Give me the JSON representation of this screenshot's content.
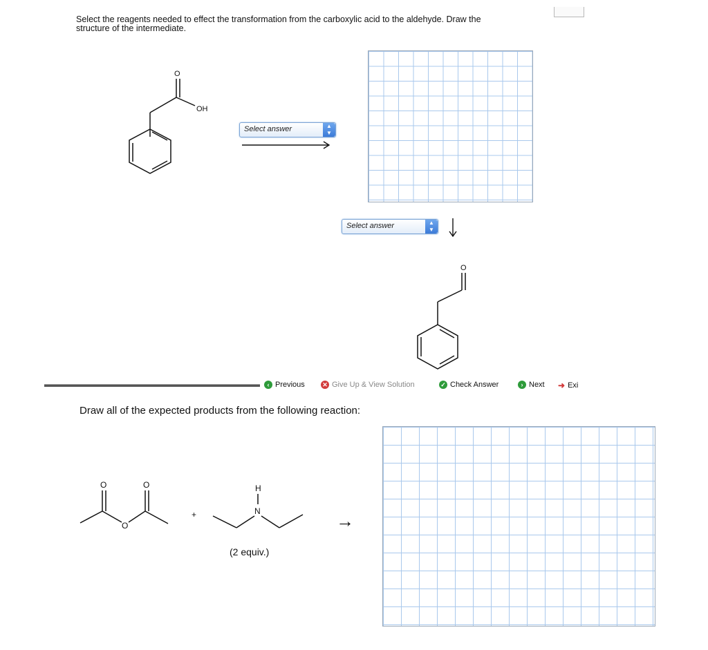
{
  "question1": {
    "prompt_line1": "Select the reagents needed to effect the transformation from the carboxylic acid to the aldehyde. Draw the",
    "prompt_line2": "structure of the intermediate.",
    "corner_tab": "",
    "starting_material": {
      "label_o": "O",
      "label_oh": "OH"
    },
    "select1": {
      "value": "Select answer"
    },
    "select2": {
      "value": "Select answer"
    },
    "product": {
      "label_o": "O"
    }
  },
  "nav": {
    "previous": "Previous",
    "give_up": "Give Up & View Solution",
    "check": "Check Answer",
    "next": "Next",
    "exit": "Exi",
    "colors": {
      "green": "#2e9b3a",
      "red": "#d23c3c",
      "give_up_text": "#888888"
    }
  },
  "question2": {
    "prompt": "Draw all of the expected products from the following reaction:",
    "reactant1": {
      "label_o1": "O",
      "label_o2": "O",
      "label_o_bridge": "O"
    },
    "plus": "+",
    "reactant2": {
      "label_h": "H",
      "label_n": "N"
    },
    "equiv": "(2 equiv.)",
    "arrow": "→"
  },
  "icons": [
    "arrow-right-icon",
    "arrow-down-icon",
    "previous-icon",
    "give-up-icon",
    "check-icon",
    "next-icon",
    "exit-icon"
  ]
}
